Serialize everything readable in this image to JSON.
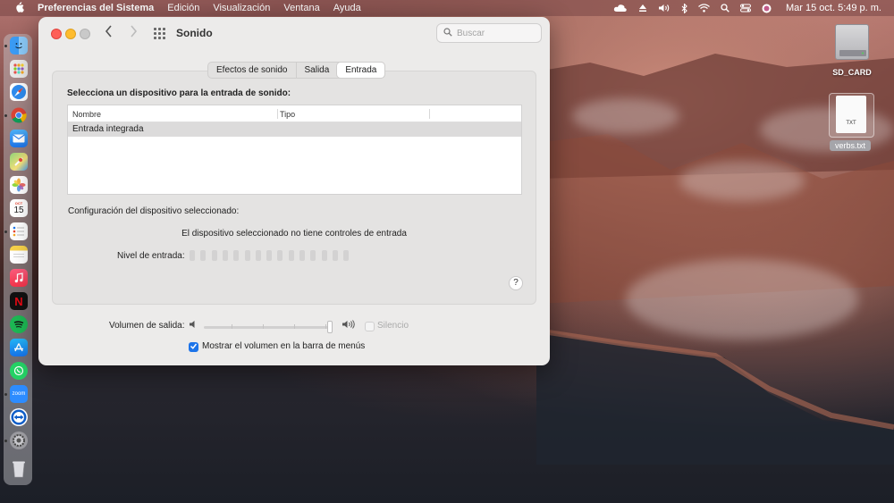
{
  "menubar": {
    "apple_icon": "apple-icon",
    "app_name": "Preferencias del Sistema",
    "menus": [
      "Edición",
      "Visualización",
      "Ventana",
      "Ayuda"
    ],
    "status_icons": [
      "cloud-icon",
      "eject-icon",
      "volume-icon",
      "bluetooth-icon",
      "wifi-icon",
      "search-icon",
      "control-center-icon",
      "siri-icon"
    ],
    "datetime": "Mar 15 oct.  5:49 p. m."
  },
  "dock": {
    "apps": [
      "finder-icon",
      "launchpad-icon",
      "safari-icon",
      "chrome-icon",
      "mail-icon",
      "maps-icon",
      "photos-icon",
      "calendar-icon",
      "reminders-icon",
      "notes-icon",
      "music-icon",
      "netflix-icon",
      "spotify-icon",
      "app-store-icon",
      "whatsapp-icon",
      "zoom-icon",
      "teamviewer-icon",
      "system-preferences-icon",
      "trash-icon"
    ],
    "calendar_month": "OCT",
    "calendar_day": "15",
    "zoom_label": "zoom",
    "netflix_label": "N"
  },
  "desktop": {
    "sd_card_label": "SD_CARD",
    "txt_file_badge": "TXT",
    "txt_file_label": "verbs.txt"
  },
  "window": {
    "title": "Sonido",
    "search_placeholder": "Buscar",
    "tabs": [
      {
        "label": "Efectos de sonido",
        "active": false
      },
      {
        "label": "Salida",
        "active": false
      },
      {
        "label": "Entrada",
        "active": true
      }
    ],
    "heading": "Selecciona un dispositivo para la entrada de sonido:",
    "table": {
      "columns": [
        "Nombre",
        "Tipo"
      ],
      "rows": [
        {
          "name": "Entrada integrada",
          "type": ""
        }
      ]
    },
    "config_label": "Configuración del dispositivo seleccionado:",
    "no_controls_text": "El dispositivo seleccionado no tiene controles de entrada",
    "input_level_label": "Nivel de entrada:",
    "input_level_segments": 15,
    "input_level_active": 0,
    "help_label": "?",
    "output_volume_label": "Volumen de salida:",
    "output_volume": 1.0,
    "mute_label": "Silencio",
    "mute_checked": false,
    "show_in_menubar_label": "Mostrar el volumen en la barra de menús",
    "show_in_menubar_checked": true
  },
  "colors": {
    "accent": "#1d74e9",
    "close": "#fe5f57",
    "minimize": "#febc2e"
  }
}
